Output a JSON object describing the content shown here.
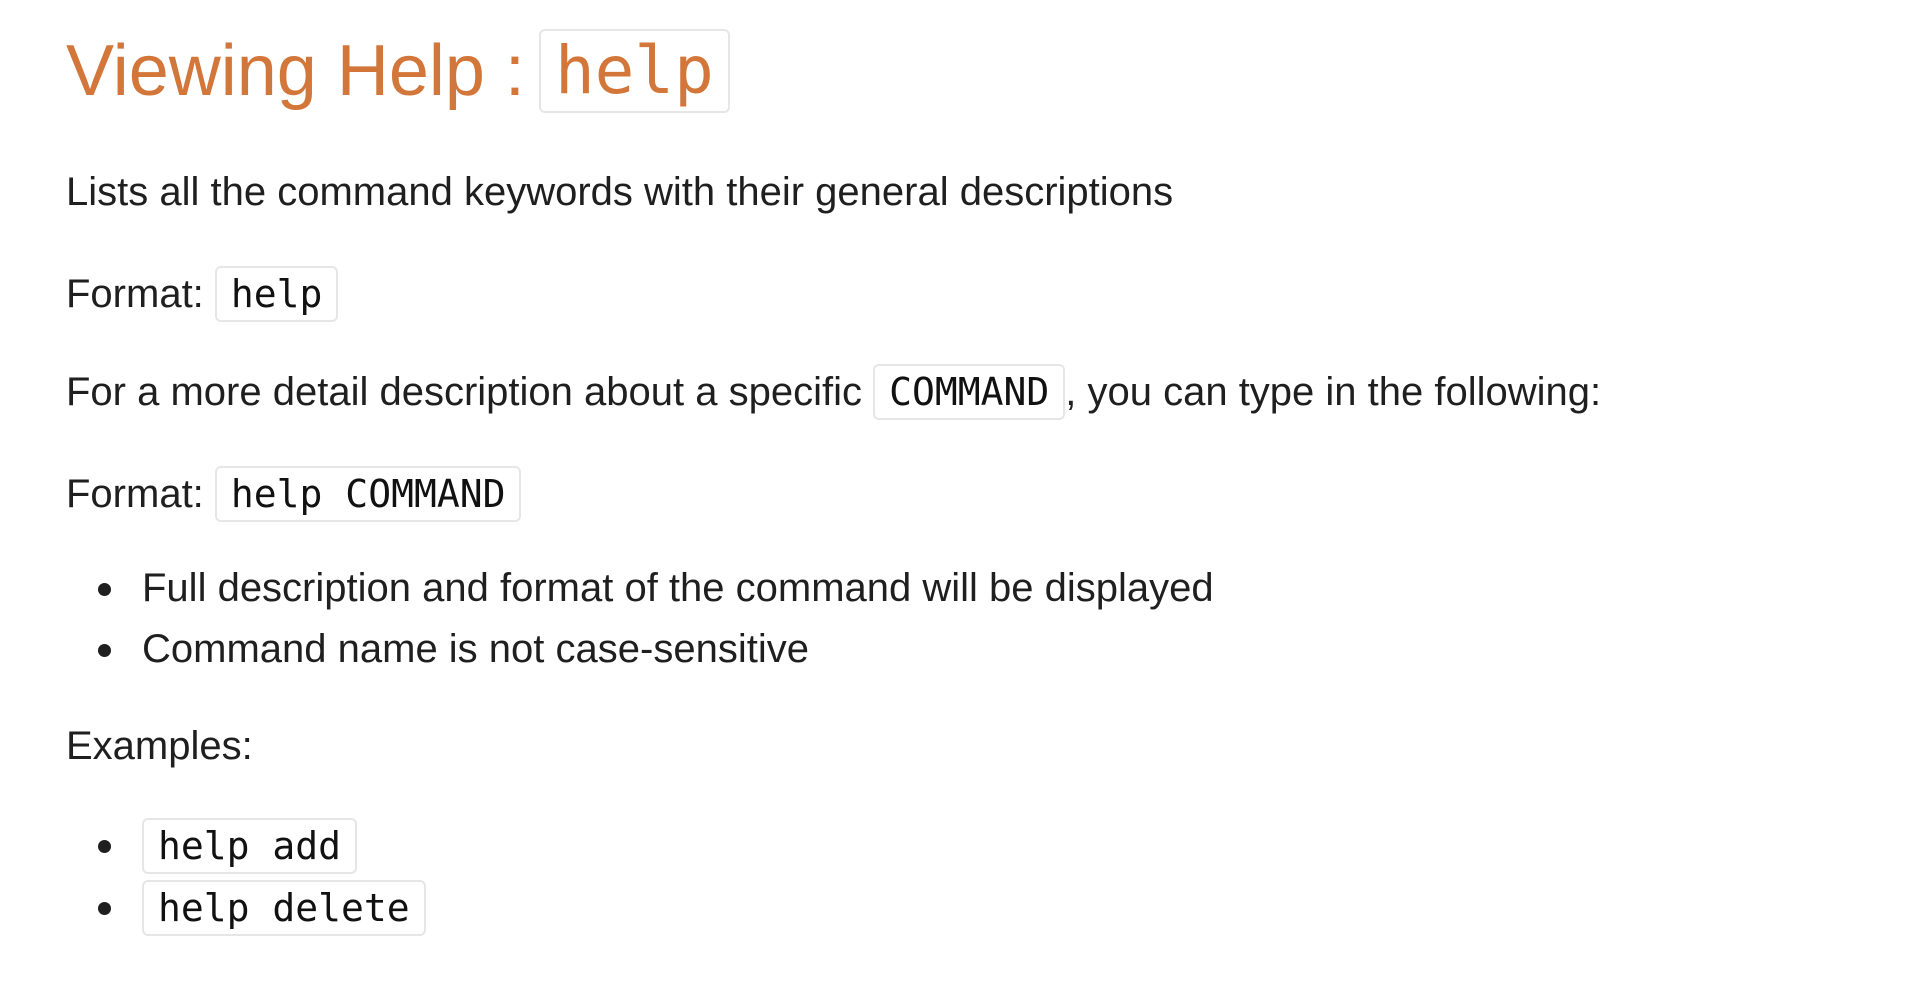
{
  "heading": {
    "text": "Viewing Help :",
    "code": "help"
  },
  "intro": "Lists all the command keywords with their general descriptions",
  "format1": {
    "label": "Format:",
    "code": "help"
  },
  "detail": {
    "before": "For a more detail description about a specific",
    "code": "COMMAND",
    "after": ", you can type in the following:"
  },
  "format2": {
    "label": "Format:",
    "code": "help COMMAND"
  },
  "notes": [
    "Full description and format of the command will be displayed",
    "Command name is not case-sensitive"
  ],
  "examples_label": "Examples:",
  "examples": [
    "help add",
    "help delete"
  ],
  "colors": {
    "heading": "#d2763a",
    "text": "#1f1f1f",
    "code_border": "#e6e6e6"
  }
}
